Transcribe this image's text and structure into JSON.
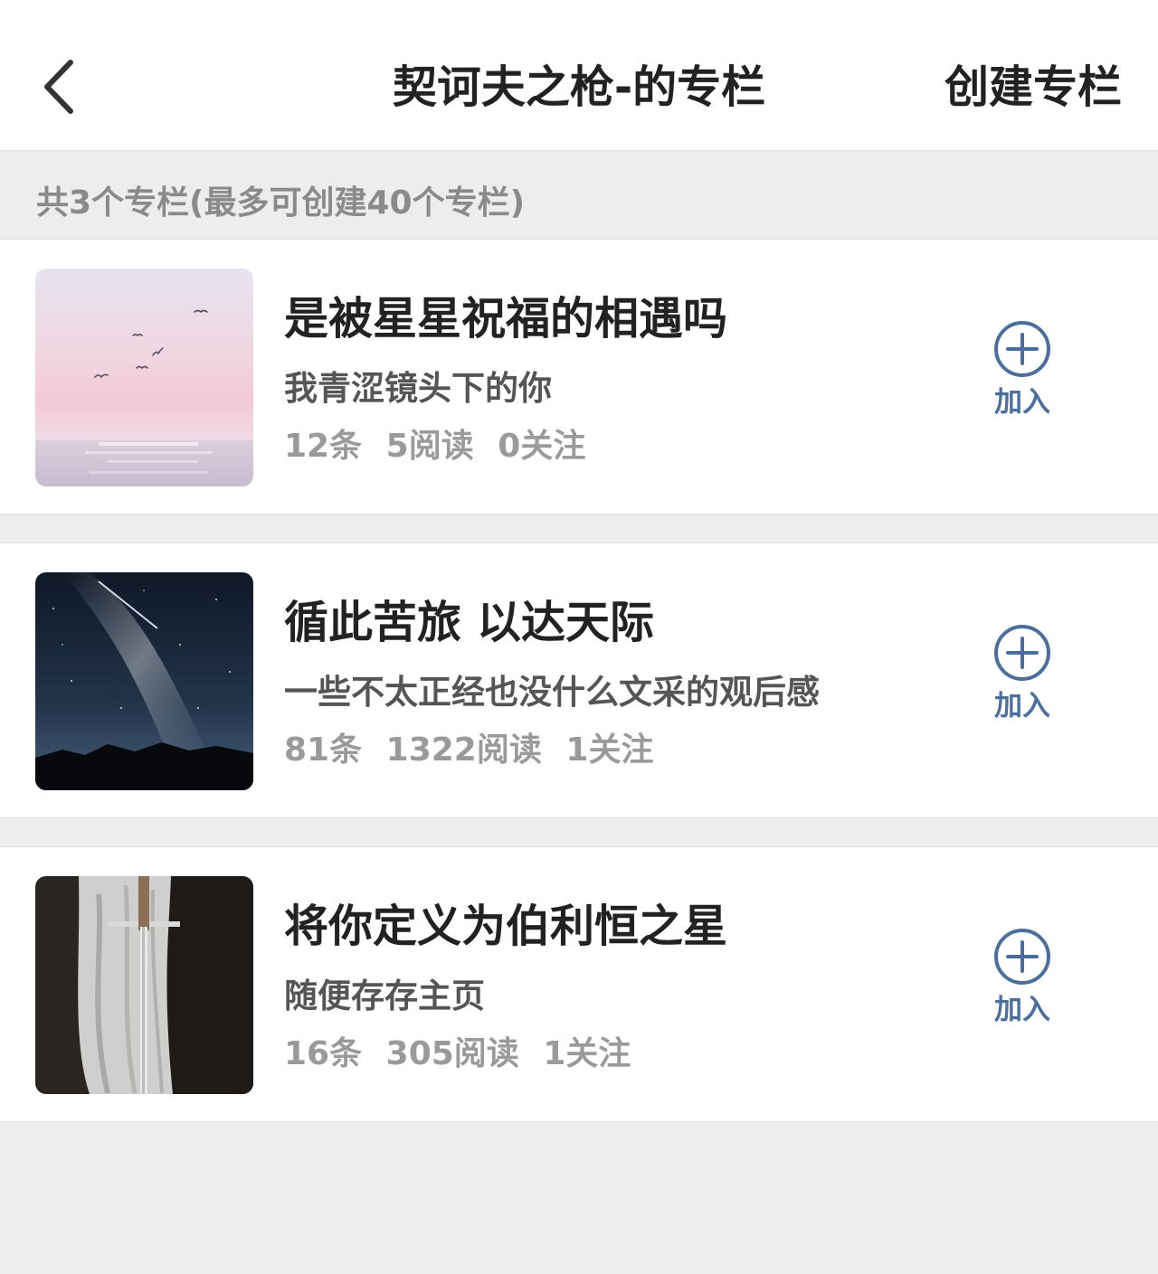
{
  "header": {
    "title": "契诃夫之枪-的专栏",
    "create_label": "创建专栏"
  },
  "summary": "共3个专栏(最多可创建40个专栏)",
  "columns": [
    {
      "title": "是被星星祝福的相遇吗",
      "desc": "我青涩镜头下的你",
      "items": "12条",
      "reads": "5阅读",
      "follows": "0关注",
      "join_label": "加入"
    },
    {
      "title": "循此苦旅 以达天际",
      "desc": "一些不太正经也没什么文采的观后感",
      "items": "81条",
      "reads": "1322阅读",
      "follows": "1关注",
      "join_label": "加入"
    },
    {
      "title": "将你定义为伯利恒之星",
      "desc": "随便存存主页",
      "items": "16条",
      "reads": "305阅读",
      "follows": "1关注",
      "join_label": "加入"
    }
  ],
  "icons": {
    "back": "chevron-left-icon",
    "join": "plus-circle-icon"
  },
  "colors": {
    "accent": "#4a6f9e",
    "background": "#ededed",
    "text_primary": "#222222",
    "text_secondary": "#555555",
    "text_muted": "#9a9a9a"
  }
}
